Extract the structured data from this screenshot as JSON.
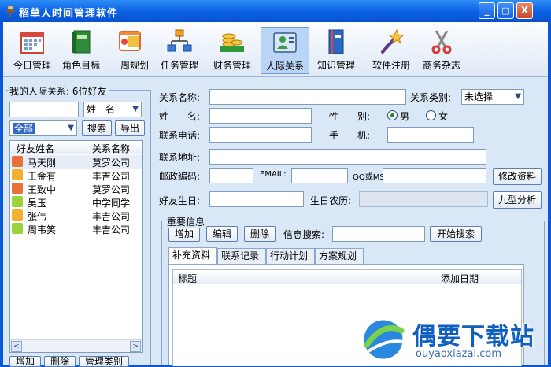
{
  "window": {
    "title": "稻草人时间管理软件",
    "buttons": {
      "minimize": "_",
      "maximize": "□",
      "close": "X"
    }
  },
  "toolbar": {
    "items": [
      {
        "label": "今日管理",
        "icon": "calendar-icon"
      },
      {
        "label": "角色目标",
        "icon": "book-icon"
      },
      {
        "label": "一周规划",
        "icon": "week-plan-icon"
      },
      {
        "label": "任务管理",
        "icon": "hierarchy-icon"
      },
      {
        "label": "财务管理",
        "icon": "coins-icon"
      },
      {
        "label": "人际关系",
        "icon": "contact-card-icon",
        "active": true
      },
      {
        "label": "知识管理",
        "icon": "knowledge-book-icon"
      },
      {
        "label": "软件注册",
        "icon": "magic-wand-icon"
      },
      {
        "label": "商务杂志",
        "icon": "scissors-icon"
      }
    ]
  },
  "left": {
    "legend": "我的人际关系: 6位好友",
    "search_input": "",
    "field_select": "姓　名",
    "group_select": "全部",
    "search_button": "搜索",
    "export_button": "导出",
    "list_headers": {
      "name": "好友姓名",
      "relation": "关系名称"
    },
    "friends": [
      {
        "name": "马天刚",
        "relation": "莫罗公司",
        "gender": "male"
      },
      {
        "name": "王金有",
        "relation": "丰吉公司",
        "gender": "female"
      },
      {
        "name": "王致中",
        "relation": "莫罗公司",
        "gender": "male"
      },
      {
        "name": "吴玉",
        "relation": "中学同学",
        "gender": "other"
      },
      {
        "name": "张伟",
        "relation": "丰吉公司",
        "gender": "female"
      },
      {
        "name": "周韦笑",
        "relation": "丰吉公司",
        "gender": "other"
      }
    ],
    "bottom_buttons": {
      "add": "增加",
      "delete": "删除",
      "manage": "管理类别"
    },
    "scroll_left": "<",
    "scroll_right": ">"
  },
  "form": {
    "relation_name_label": "关系名称:",
    "relation_type_label": "关系类别:",
    "relation_type_value": "未选择",
    "name_label": "姓　　名:",
    "gender_label": "性　　别:",
    "gender_male": "男",
    "gender_female": "女",
    "phone_label": "联系电话:",
    "mobile_label": "手　　机:",
    "address_label": "联系地址:",
    "postcode_label": "邮政编码:",
    "email_label": "EMAIL:",
    "qq_label": "QQ或MSN:",
    "modify_button": "修改资料",
    "birthday_label": "好友生日:",
    "lunar_label": "生日农历:",
    "analysis_button": "九型分析"
  },
  "info": {
    "legend": "重要信息",
    "add_button": "增加",
    "edit_button": "编辑",
    "delete_button": "删除",
    "search_label": "信息搜索:",
    "start_search_button": "开始搜索",
    "tabs": [
      "补充资料",
      "联系记录",
      "行动计划",
      "方案规划"
    ],
    "grid_headers": {
      "title": "标题",
      "date": "添加日期"
    }
  },
  "watermark": {
    "text": "偶要下载站",
    "url": "ouyaoxiazai.com"
  },
  "colors": {
    "titlebar": "#0a5fe0",
    "panel": "#dae7f6",
    "selection": "#316ac5"
  }
}
